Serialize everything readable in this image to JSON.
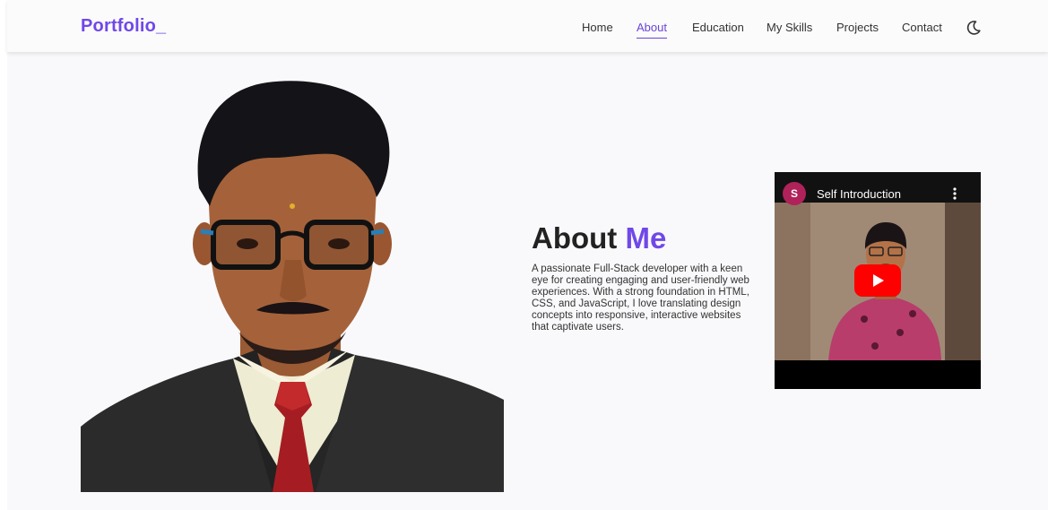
{
  "brand": {
    "logo_text": "Portfolio_"
  },
  "nav": {
    "items": [
      {
        "label": "Home",
        "active": false
      },
      {
        "label": "About",
        "active": true
      },
      {
        "label": "Education",
        "active": false
      },
      {
        "label": "My Skills",
        "active": false
      },
      {
        "label": "Projects",
        "active": false
      },
      {
        "label": "Contact",
        "active": false
      }
    ],
    "theme_toggle_icon": "moon-icon"
  },
  "about": {
    "title_prefix": "About",
    "title_accent": "Me",
    "description": "A passionate Full-Stack developer with a keen eye for creating engaging and user-friendly web experiences. With a strong foundation in HTML, CSS, and JavaScript, I love translating design concepts into responsive, interactive websites that captivate users."
  },
  "video": {
    "channel_initial": "S",
    "title": "Self Introduction",
    "menu_icon": "more-vert-icon",
    "play_icon": "youtube-play-icon"
  },
  "colors": {
    "accent": "#7048e8",
    "text": "#222222",
    "youtube_red": "#ff0000",
    "avatar": "#b0225a"
  }
}
